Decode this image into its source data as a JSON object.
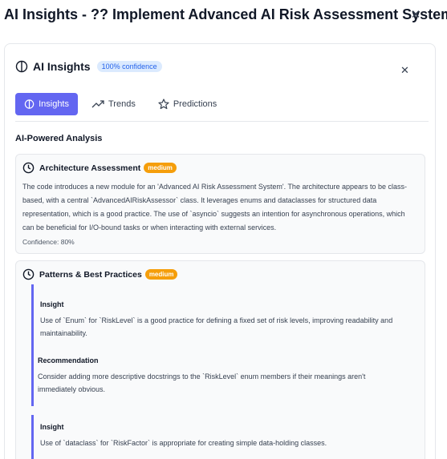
{
  "dialog": {
    "title": "AI Insights - ?? Implement Advanced AI Risk Assessment System",
    "close_glyph": "✕"
  },
  "panel": {
    "title": "AI Insights",
    "confidence_badge": "100% confidence",
    "close_glyph": "✕",
    "tabs": [
      {
        "label": "Insights",
        "icon": "brain-icon",
        "active": true
      },
      {
        "label": "Trends",
        "icon": "trend-line-icon",
        "active": false
      },
      {
        "label": "Predictions",
        "icon": "star-icon",
        "active": false
      }
    ],
    "section_heading": "AI-Powered Analysis",
    "cards": [
      {
        "title": "Architecture Assessment",
        "level": "medium",
        "icon": "clock-icon",
        "lines": [
          "The code introduces a new module for an 'Advanced AI Risk Assessment System'. The architecture appears to be class-",
          "based, with a central `AdvancedAIRiskAssessor` class. It leverages enums and dataclasses for structured data",
          "representation, which is a good practice. The use of `asyncio` suggests an intention for asynchronous operations, which",
          "can be beneficial for I/O-bound tasks or when interacting with external services."
        ],
        "confidence": "Confidence: 80%"
      },
      {
        "title": "Patterns & Best Practices",
        "level": "medium",
        "icon": "clock-icon",
        "entries": [
          {
            "type": "Insight",
            "lines": [
              "Use of `Enum` for `RiskLevel` is a good practice for defining a fixed set of risk levels, improving readability and",
              "maintainability."
            ]
          },
          {
            "type": "Recommendation",
            "lines": [
              "Consider adding more descriptive docstrings to the `RiskLevel` enum members if their meanings aren't",
              "immediately obvious."
            ]
          },
          {
            "type": "Insight",
            "lines": [
              "Use of `dataclass` for `RiskFactor` is appropriate for creating simple data-holding classes."
            ]
          }
        ]
      }
    ]
  },
  "colors": {
    "accent": "#6366f1",
    "badge_blue_bg": "#dbeafe",
    "badge_blue_text": "#2563eb",
    "medium_badge": "#f59e0b"
  }
}
